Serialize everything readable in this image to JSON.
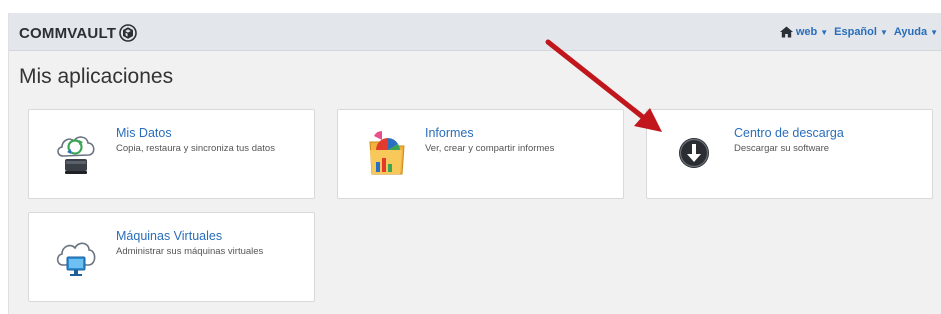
{
  "header": {
    "logo_text": "COMMVAULT",
    "nav": [
      {
        "label": "web"
      },
      {
        "label": "Español"
      },
      {
        "label": "Ayuda"
      }
    ]
  },
  "main": {
    "title": "Mis aplicaciones",
    "apps": [
      {
        "title": "Mis Datos",
        "description": "Copia, restaura y sincroniza tus datos",
        "icon": "cloud-sync-icon"
      },
      {
        "title": "Informes",
        "description": "Ver, crear y compartir informes",
        "icon": "reports-folder-icon"
      },
      {
        "title": "Centro de descarga",
        "description": "Descargar su software",
        "icon": "download-icon"
      },
      {
        "title": "Máquinas Virtuales",
        "description": "Administrar sus máquinas virtuales",
        "icon": "cloud-monitor-icon"
      }
    ]
  },
  "annotation": {
    "color": "#c0161c",
    "icon": "red-arrow-icon"
  },
  "colors": {
    "link": "#2a6ebb",
    "topbar": "#e3e6ea",
    "background": "#f1f1f1"
  }
}
